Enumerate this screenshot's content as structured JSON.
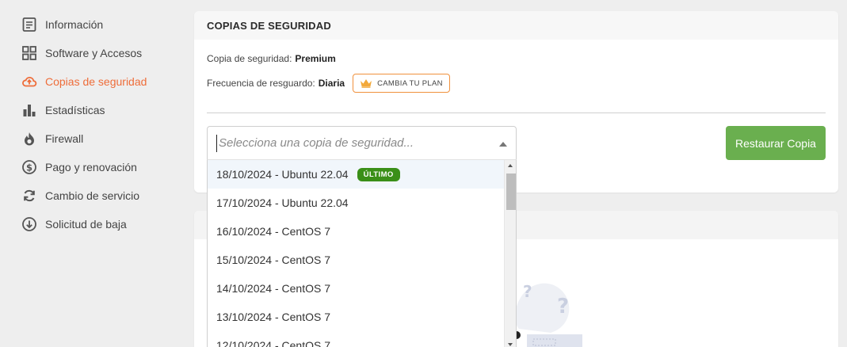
{
  "sidebar": {
    "items": [
      {
        "label": "Información",
        "icon": "document-icon"
      },
      {
        "label": "Software y Accesos",
        "icon": "grid-icon"
      },
      {
        "label": "Copias de seguridad",
        "icon": "cloud-upload-icon",
        "active": true
      },
      {
        "label": "Estadísticas",
        "icon": "bar-chart-icon"
      },
      {
        "label": "Firewall",
        "icon": "fire-icon"
      },
      {
        "label": "Pago y renovación",
        "icon": "dollar-icon"
      },
      {
        "label": "Cambio de servicio",
        "icon": "refresh-icon"
      },
      {
        "label": "Solicitud de baja",
        "icon": "arrow-down-circle-icon"
      }
    ]
  },
  "backup_card": {
    "title": "COPIAS DE SEGURIDAD",
    "backup_label": "Copia de seguridad:",
    "backup_value": "Premium",
    "frequency_label": "Frecuencia de resguardo:",
    "frequency_value": "Diaria",
    "plan_button": "CAMBIA TU PLAN",
    "restore_button": "Restaurar Copia",
    "select_placeholder": "Selecciona una copia de seguridad..."
  },
  "dropdown": {
    "latest_badge": "ÚLTIMO",
    "options": [
      "18/10/2024 - Ubuntu 22.04",
      "17/10/2024 - Ubuntu 22.04",
      "16/10/2024 - CentOS 7",
      "15/10/2024 - CentOS 7",
      "14/10/2024 - CentOS 7",
      "13/10/2024 - CentOS 7",
      "12/10/2024 - CentOS 7"
    ]
  },
  "colors": {
    "accent": "#ee6d3a",
    "restore_button": "#6aaf4f",
    "latest_badge": "#3a8f18"
  }
}
